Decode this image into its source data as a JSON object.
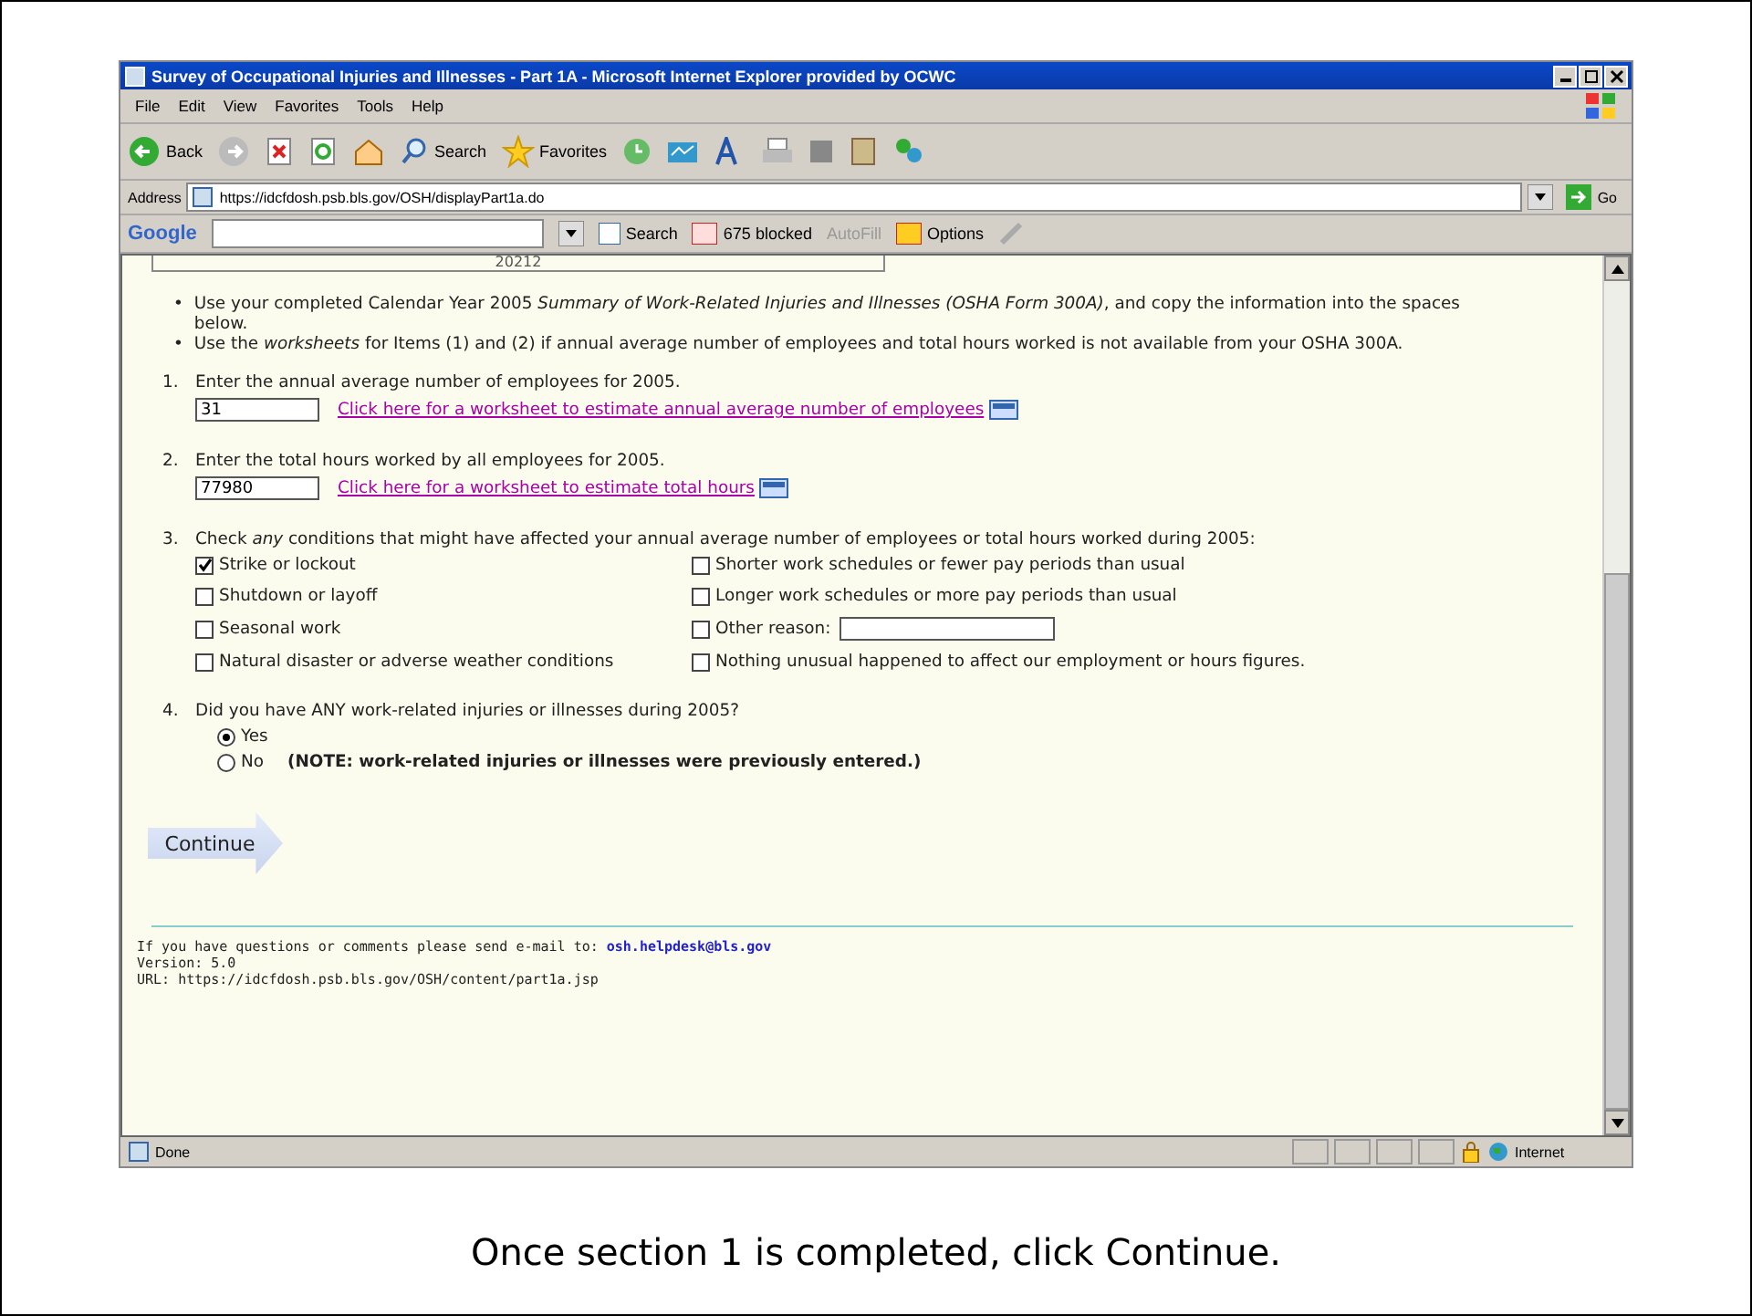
{
  "window": {
    "title": "Survey of Occupational Injuries and Illnesses - Part 1A - Microsoft Internet Explorer provided by OCWC"
  },
  "menu": [
    "File",
    "Edit",
    "View",
    "Favorites",
    "Tools",
    "Help"
  ],
  "toolbar": {
    "back": "Back",
    "search": "Search",
    "favorites": "Favorites"
  },
  "address": {
    "label": "Address",
    "url": "https://idcfdosh.psb.bls.gov/OSH/displayPart1a.do",
    "go": "Go"
  },
  "google_bar": {
    "logo": "Google",
    "search": "Search",
    "blocked": "675 blocked",
    "autofill": "AutoFill",
    "options": "Options"
  },
  "page": {
    "top_box": "20212",
    "bullets": [
      {
        "marker": "•",
        "text": "Use your completed Calendar Year 2005 *Summary of Work-Related Injuries and Illnesses (OSHA Form 300A)*, and copy the information into the spaces below."
      },
      {
        "marker": "•",
        "text": "Use the *worksheets* for Items (1) and (2) if annual average number of employees and total hours worked is not available from your OSHA 300A."
      }
    ],
    "q1": {
      "number": "1.",
      "label": "Enter the annual average number of employees for 2005.",
      "value": "31",
      "link": "Click here for a worksheet to estimate annual average number of employees"
    },
    "q2": {
      "number": "2.",
      "label": "Enter the total hours worked by all employees for 2005.",
      "value": "77980",
      "link": "Click here for a worksheet to estimate total hours"
    },
    "q3": {
      "number": "3.",
      "label": "Check *any* conditions that might have affected your annual average number of employees or total hours worked during 2005:",
      "options": [
        {
          "label": "Strike or lockout",
          "checked": true,
          "kind": "plain"
        },
        {
          "label": "Shorter work schedules or fewer pay periods than usual",
          "checked": false,
          "kind": "plain"
        },
        {
          "label": "Shutdown or layoff",
          "checked": false,
          "kind": "plain"
        },
        {
          "label": "Longer work schedules or more pay periods than usual",
          "checked": false,
          "kind": "plain"
        },
        {
          "label": "Seasonal work",
          "checked": false,
          "kind": "plain"
        },
        {
          "label": "Other reason:",
          "checked": false,
          "kind": "text"
        },
        {
          "label": "Natural disaster or adverse weather conditions",
          "checked": false,
          "kind": "plain"
        },
        {
          "label": "Nothing unusual happened to affect our employment or hours figures.",
          "checked": false,
          "kind": "plain"
        }
      ]
    },
    "q4": {
      "number": "4.",
      "label": "Did you have ANY work-related injuries or illnesses during 2005?",
      "options": [
        {
          "label": "Yes",
          "selected": true
        },
        {
          "label": "No",
          "selected": false,
          "note": "(NOTE: work-related injuries or illnesses were previously entered.)"
        }
      ]
    },
    "continue": "Continue",
    "footer": {
      "contact": "If you have questions or comments please send e-mail to:",
      "email": "osh.helpdesk@bls.gov",
      "version": "Version: 5.0",
      "url": "URL: https://idcfdosh.psb.bls.gov/OSH/content/part1a.jsp"
    }
  },
  "status_bar": {
    "status": "Done",
    "zone": "Internet"
  },
  "caption": "Once section 1 is completed, click Continue."
}
